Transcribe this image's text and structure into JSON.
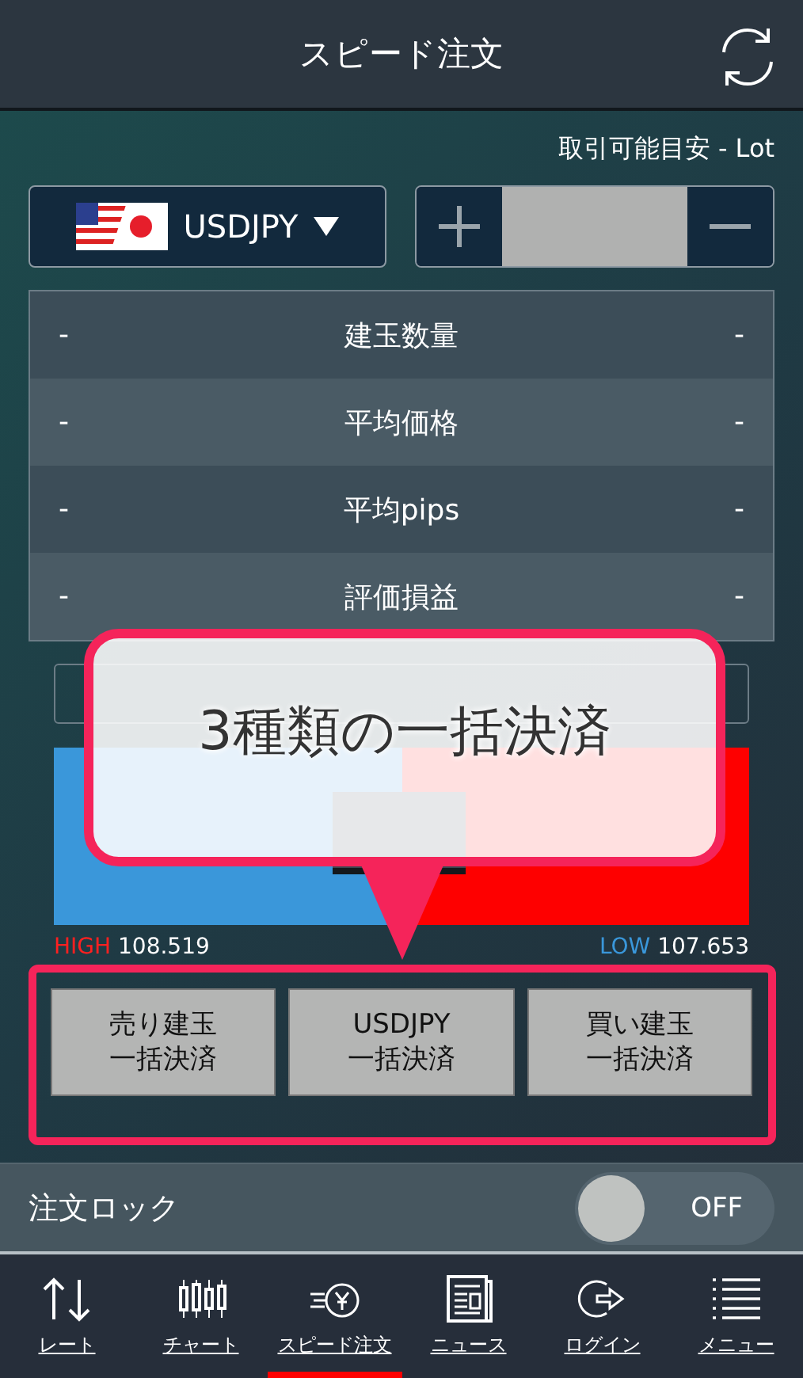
{
  "header": {
    "title": "スピード注文"
  },
  "available": "取引可能目安 - Lot",
  "pair": {
    "label": "USDJPY"
  },
  "positions": [
    {
      "left": "-",
      "label": "建玉数量",
      "right": "-"
    },
    {
      "left": "-",
      "label": "平均価格",
      "right": "-"
    },
    {
      "left": "-",
      "label": "平均pips",
      "right": "-"
    },
    {
      "left": "-",
      "label": "評価損益",
      "right": "-"
    }
  ],
  "high": {
    "label": "HIGH",
    "value": "108.519"
  },
  "low": {
    "label": "LOW",
    "value": "107.653"
  },
  "bulk_buttons": [
    {
      "lines": [
        "売り建玉",
        "一括決済"
      ]
    },
    {
      "lines": [
        "USDJPY",
        "一括決済"
      ]
    },
    {
      "lines": [
        "買い建玉",
        "一括決済"
      ]
    }
  ],
  "order_lock": {
    "label": "注文ロック",
    "on": false,
    "state_label": "OFF"
  },
  "tabs": [
    {
      "kind": "rate",
      "label": "レート",
      "selected": false
    },
    {
      "kind": "chart",
      "label": "チャート",
      "selected": false
    },
    {
      "kind": "speed",
      "label": "スピード注文",
      "selected": true
    },
    {
      "kind": "news",
      "label": "ニュース",
      "selected": false
    },
    {
      "kind": "login",
      "label": "ログイン",
      "selected": false
    },
    {
      "kind": "menu",
      "label": "メニュー",
      "selected": false
    }
  ],
  "callout": {
    "text": "3種類の一括決済"
  }
}
